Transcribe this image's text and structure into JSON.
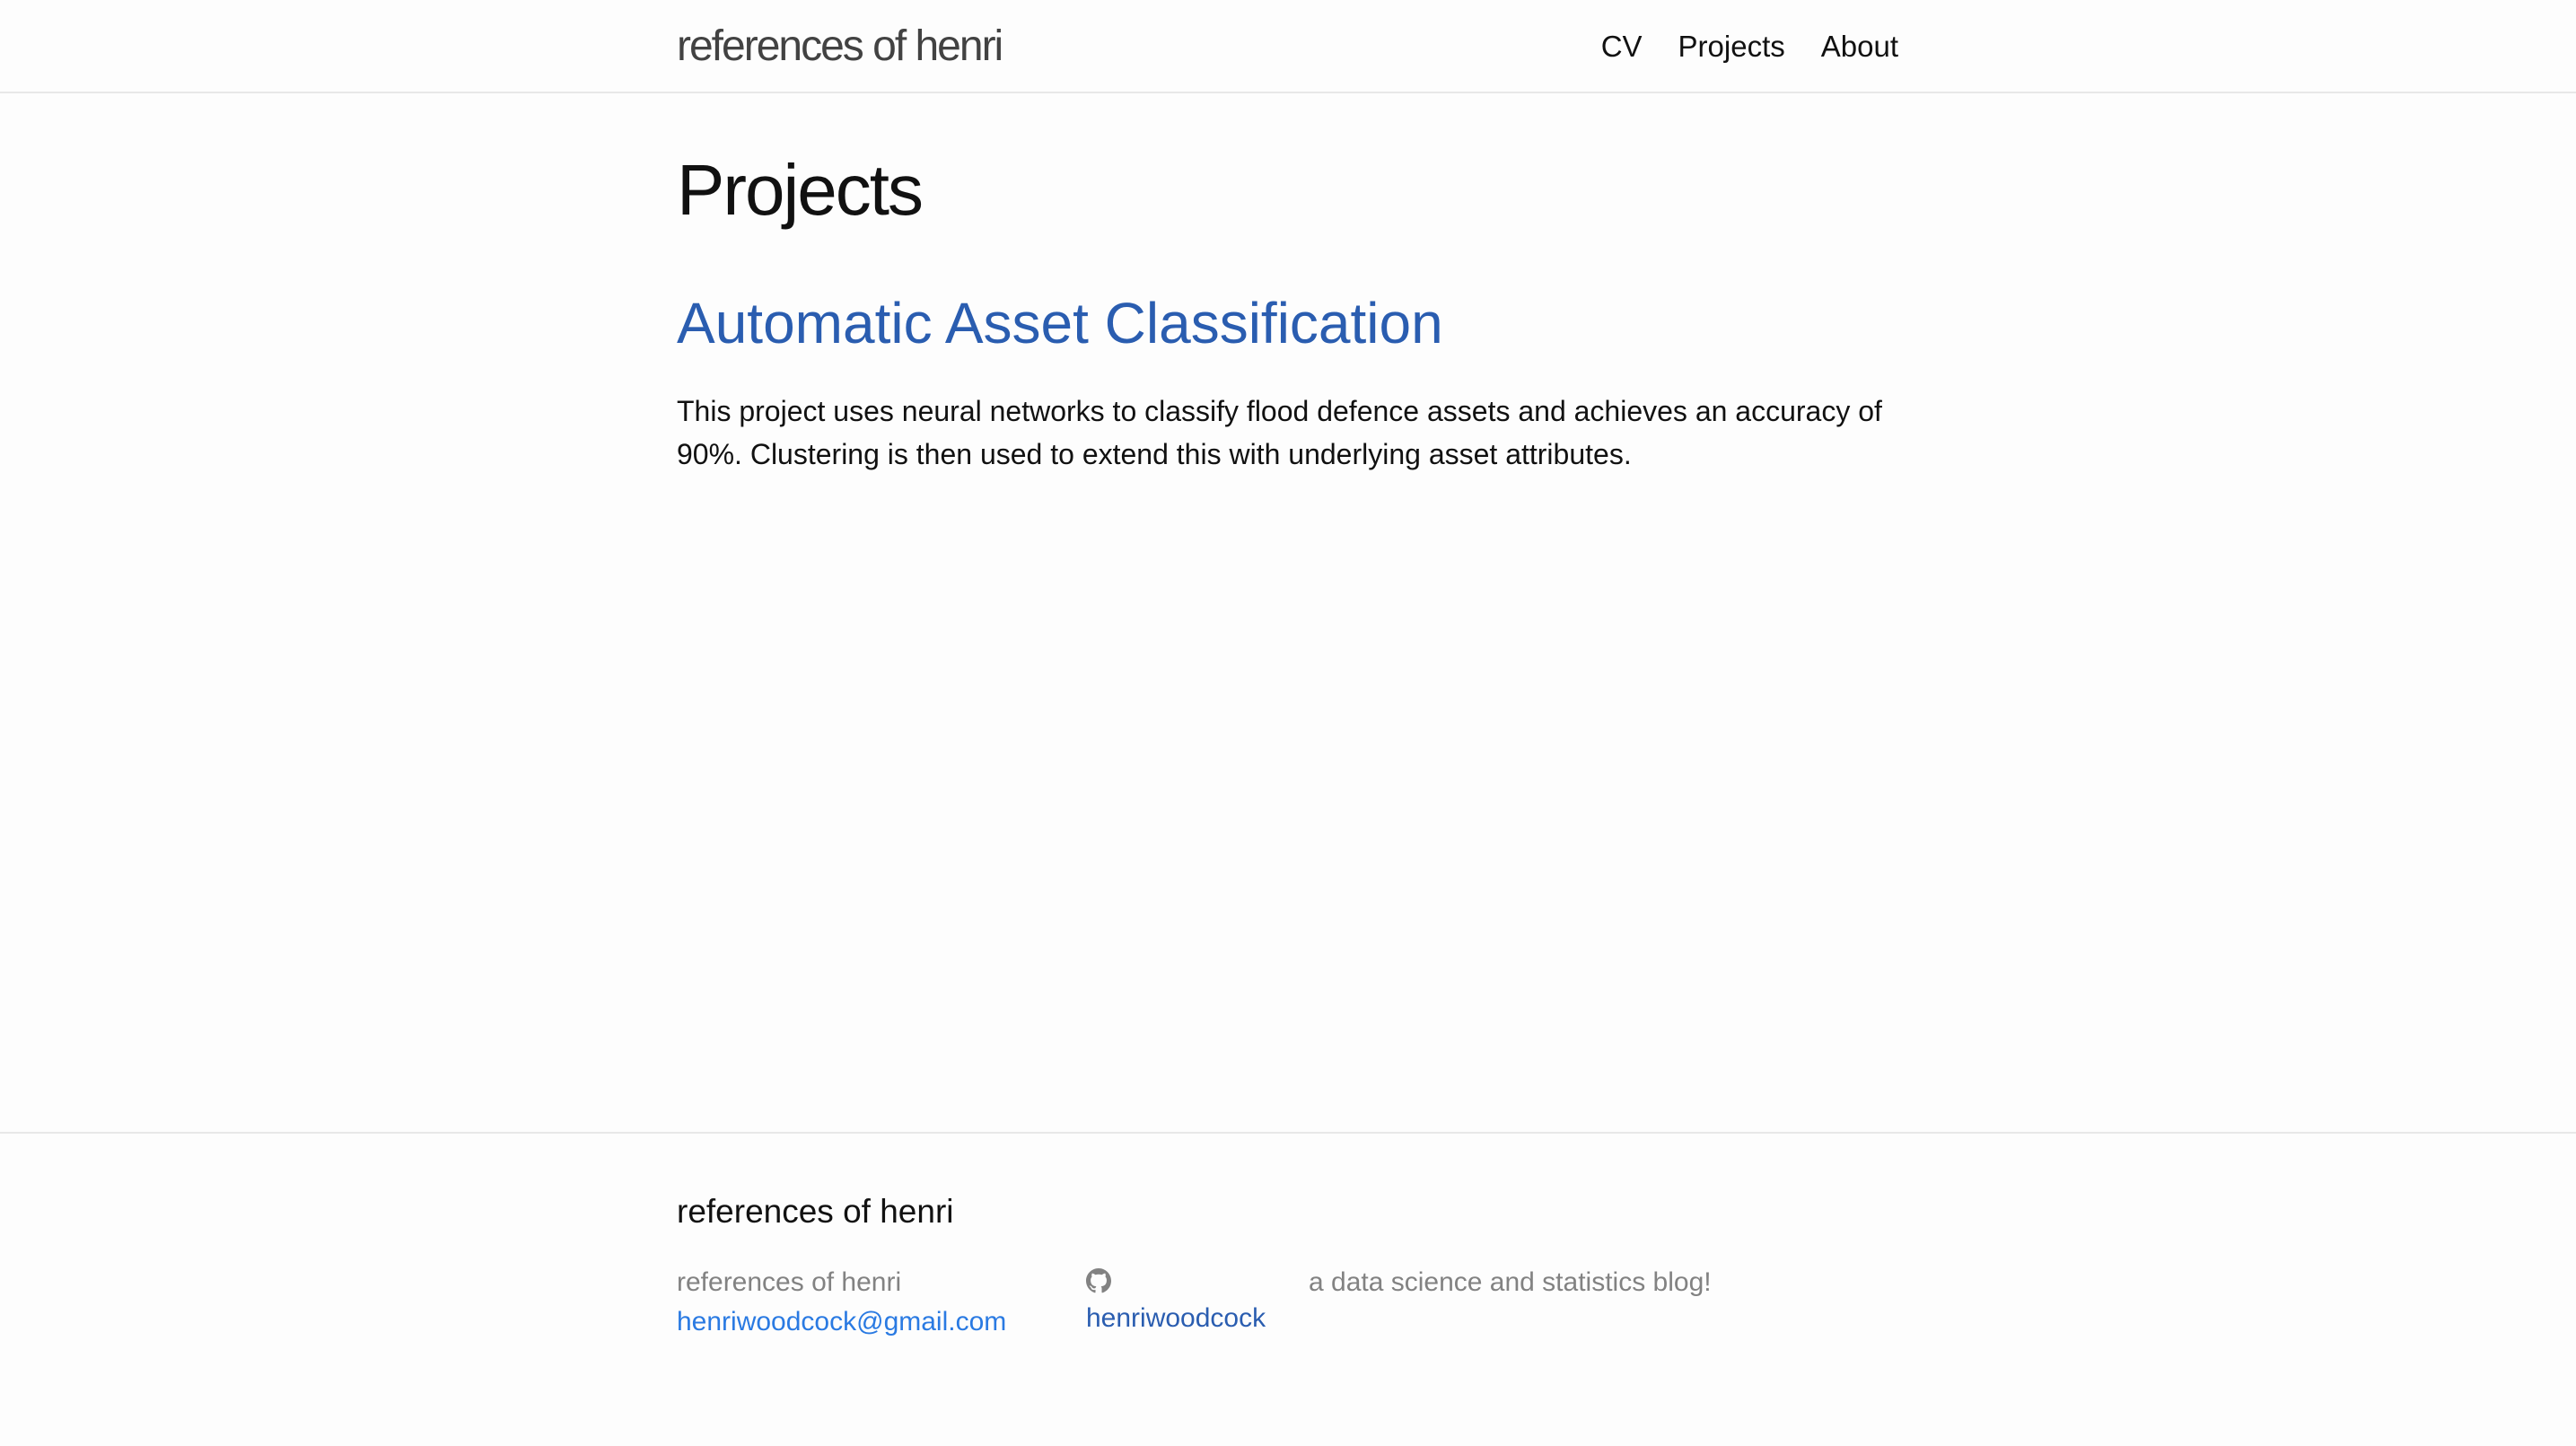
{
  "header": {
    "site_title": "references of henri",
    "nav": [
      "CV",
      "Projects",
      "About"
    ]
  },
  "main": {
    "page_title": "Projects",
    "project": {
      "title": "Automatic Asset Classification",
      "description": "This project uses neural networks to classify flood defence assets and achieves an accuracy of 90%. Clustering is then used to extend this with underlying asset attributes."
    }
  },
  "footer": {
    "heading": "references of henri",
    "name": "references of henri",
    "email": "henriwoodcock@gmail.com",
    "github_icon": "github-icon",
    "github_user": "henriwoodcock",
    "tagline": "a data science and statistics blog!"
  },
  "colors": {
    "link": "#2a5db0",
    "footer_link": "#2a7ae2",
    "muted": "#828282"
  }
}
